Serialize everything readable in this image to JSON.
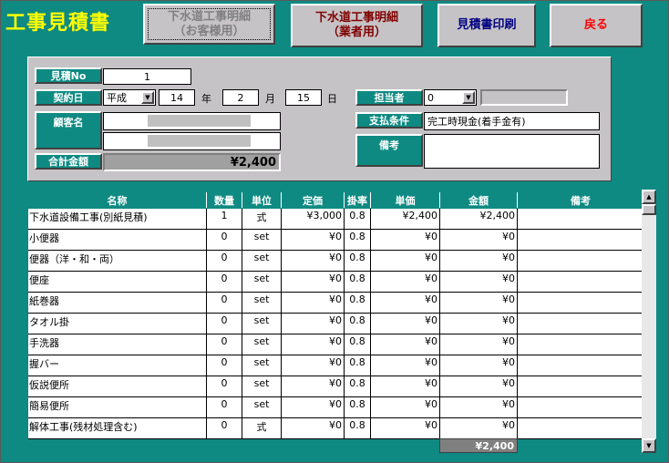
{
  "title": "工事見積書",
  "buttons": {
    "customer_detail": "下水道工事明細\n（お客様用）",
    "vendor_detail": "下水道工事明細\n（業者用）",
    "print": "見積書印刷",
    "back": "戻る"
  },
  "form": {
    "estimate_no_label": "見積No",
    "estimate_no": "1",
    "contract_date_label": "契約日",
    "era": "平成",
    "year": "14",
    "year_unit": "年",
    "month": "2",
    "month_unit": "月",
    "day": "15",
    "day_unit": "日",
    "customer_label": "顧客名",
    "total_label": "合計金額",
    "total": "¥2,400",
    "staff_label": "担当者",
    "staff": "0",
    "payment_label": "支払条件",
    "payment": "完工時現金(着手金有)",
    "remarks_label": "備考",
    "remarks": ""
  },
  "table": {
    "headers": [
      "名称",
      "数量",
      "単位",
      "定価",
      "掛率",
      "単価",
      "金額",
      "備考"
    ],
    "rows": [
      [
        "下水道設備工事(別紙見積)",
        "1",
        "式",
        "¥3,000",
        "0.8",
        "¥2,400",
        "¥2,400",
        ""
      ],
      [
        "小便器",
        "0",
        "set",
        "¥0",
        "0.8",
        "¥0",
        "¥0",
        ""
      ],
      [
        "便器（洋・和・両）",
        "0",
        "set",
        "¥0",
        "0.8",
        "¥0",
        "¥0",
        ""
      ],
      [
        "便座",
        "0",
        "set",
        "¥0",
        "0.8",
        "¥0",
        "¥0",
        ""
      ],
      [
        "紙巻器",
        "0",
        "set",
        "¥0",
        "0.8",
        "¥0",
        "¥0",
        ""
      ],
      [
        "タオル掛",
        "0",
        "set",
        "¥0",
        "0.8",
        "¥0",
        "¥0",
        ""
      ],
      [
        "手洗器",
        "0",
        "set",
        "¥0",
        "0.8",
        "¥0",
        "¥0",
        ""
      ],
      [
        "握バー",
        "0",
        "set",
        "¥0",
        "0.8",
        "¥0",
        "¥0",
        ""
      ],
      [
        "仮説便所",
        "0",
        "set",
        "¥0",
        "0.8",
        "¥0",
        "¥0",
        ""
      ],
      [
        "簡易便所",
        "0",
        "set",
        "¥0",
        "0.8",
        "¥0",
        "¥0",
        ""
      ],
      [
        "解体工事(残材処理含む)",
        "0",
        "式",
        "¥0",
        "0.8",
        "¥0",
        "¥0",
        ""
      ]
    ],
    "sum": "¥2,400"
  },
  "icons": {
    "dropdown": "chevron-down-icon",
    "scroll_up": "arrow-up-icon",
    "scroll_down": "arrow-down-icon"
  },
  "colors": {
    "background": "#0e8a82",
    "title": "#ffff00",
    "button_face": "#c6c3c6"
  }
}
